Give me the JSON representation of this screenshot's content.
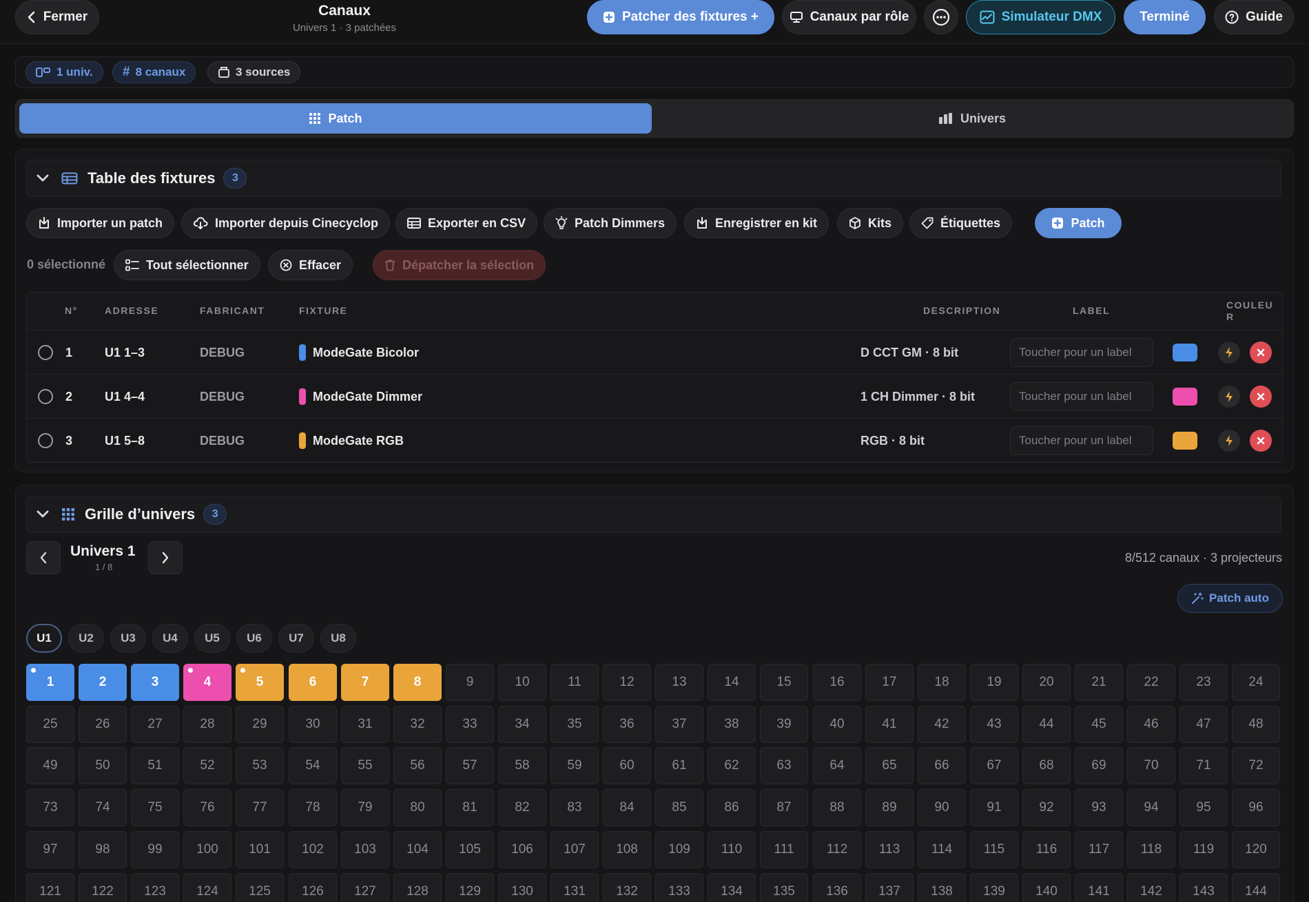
{
  "header": {
    "close_label": "Fermer",
    "title": "Canaux",
    "subtitle": "Univers 1 · 3 patchées",
    "patch_fixtures_label": "Patcher des fixtures +",
    "channels_by_role_label": "Canaux par rôle",
    "dmx_simulator_label": "Simulateur DMX",
    "done_label": "Terminé",
    "guide_label": "Guide"
  },
  "stats": {
    "universes": "1 univ.",
    "channels": "8 canaux",
    "sources": "3 sources"
  },
  "tabs": [
    {
      "label": "Patch",
      "active": true
    },
    {
      "label": "Univers",
      "active": false
    }
  ],
  "fixture_table": {
    "title": "Table des fixtures",
    "count": "3",
    "toolbar": {
      "import_patch": "Importer un patch",
      "import_cinecyclop": "Importer depuis Cinecyclop",
      "export_csv": "Exporter en CSV",
      "patch_dimmers": "Patch Dimmers",
      "save_kit": "Enregistrer en kit",
      "kits": "Kits",
      "labels": "Étiquettes",
      "patch": "Patch"
    },
    "selection": {
      "count_text": "0 sélectionné",
      "select_all": "Tout sélectionner",
      "clear": "Effacer",
      "unpatch_selection": "Dépatcher la sélection"
    },
    "columns": {
      "number": "N°",
      "address": "ADRESSE",
      "manufacturer": "FABRICANT",
      "fixture": "FIXTURE",
      "description": "DESCRIPTION",
      "label": "LABEL",
      "color_line1": "COULEU",
      "color_line2": "R"
    },
    "label_placeholder": "Toucher pour un label",
    "rows": [
      {
        "number": "1",
        "address": "U1 1–3",
        "manufacturer": "DEBUG",
        "fixture": "ModeGate Bicolor",
        "description": "D CCT GM · 8 bit",
        "color": "#4a8de6"
      },
      {
        "number": "2",
        "address": "U1 4–4",
        "manufacturer": "DEBUG",
        "fixture": "ModeGate Dimmer",
        "description": "1 CH Dimmer · 8 bit",
        "color": "#ec4fae"
      },
      {
        "number": "3",
        "address": "U1 5–8",
        "manufacturer": "DEBUG",
        "fixture": "ModeGate RGB",
        "description": "RGB · 8 bit",
        "color": "#e9a43a"
      }
    ]
  },
  "universe_grid": {
    "title": "Grille d’univers",
    "count": "3",
    "universe_name": "Univers 1",
    "universe_index": "1 / 8",
    "summary": "8/512 canaux · 3 projecteurs",
    "auto_patch_label": "Patch auto",
    "universe_chips": [
      "U1",
      "U2",
      "U3",
      "U4",
      "U5",
      "U6",
      "U7",
      "U8"
    ],
    "active_universe": "U1",
    "visible_channel_count": 144,
    "patched_channels": [
      {
        "channel": 1,
        "color": "#4a8de6",
        "start": true
      },
      {
        "channel": 2,
        "color": "#4a8de6",
        "start": false
      },
      {
        "channel": 3,
        "color": "#4a8de6",
        "start": false
      },
      {
        "channel": 4,
        "color": "#ec4fae",
        "start": true
      },
      {
        "channel": 5,
        "color": "#e9a43a",
        "start": true
      },
      {
        "channel": 6,
        "color": "#e9a43a",
        "start": false
      },
      {
        "channel": 7,
        "color": "#e9a43a",
        "start": false
      },
      {
        "channel": 8,
        "color": "#e9a43a",
        "start": false
      }
    ]
  }
}
